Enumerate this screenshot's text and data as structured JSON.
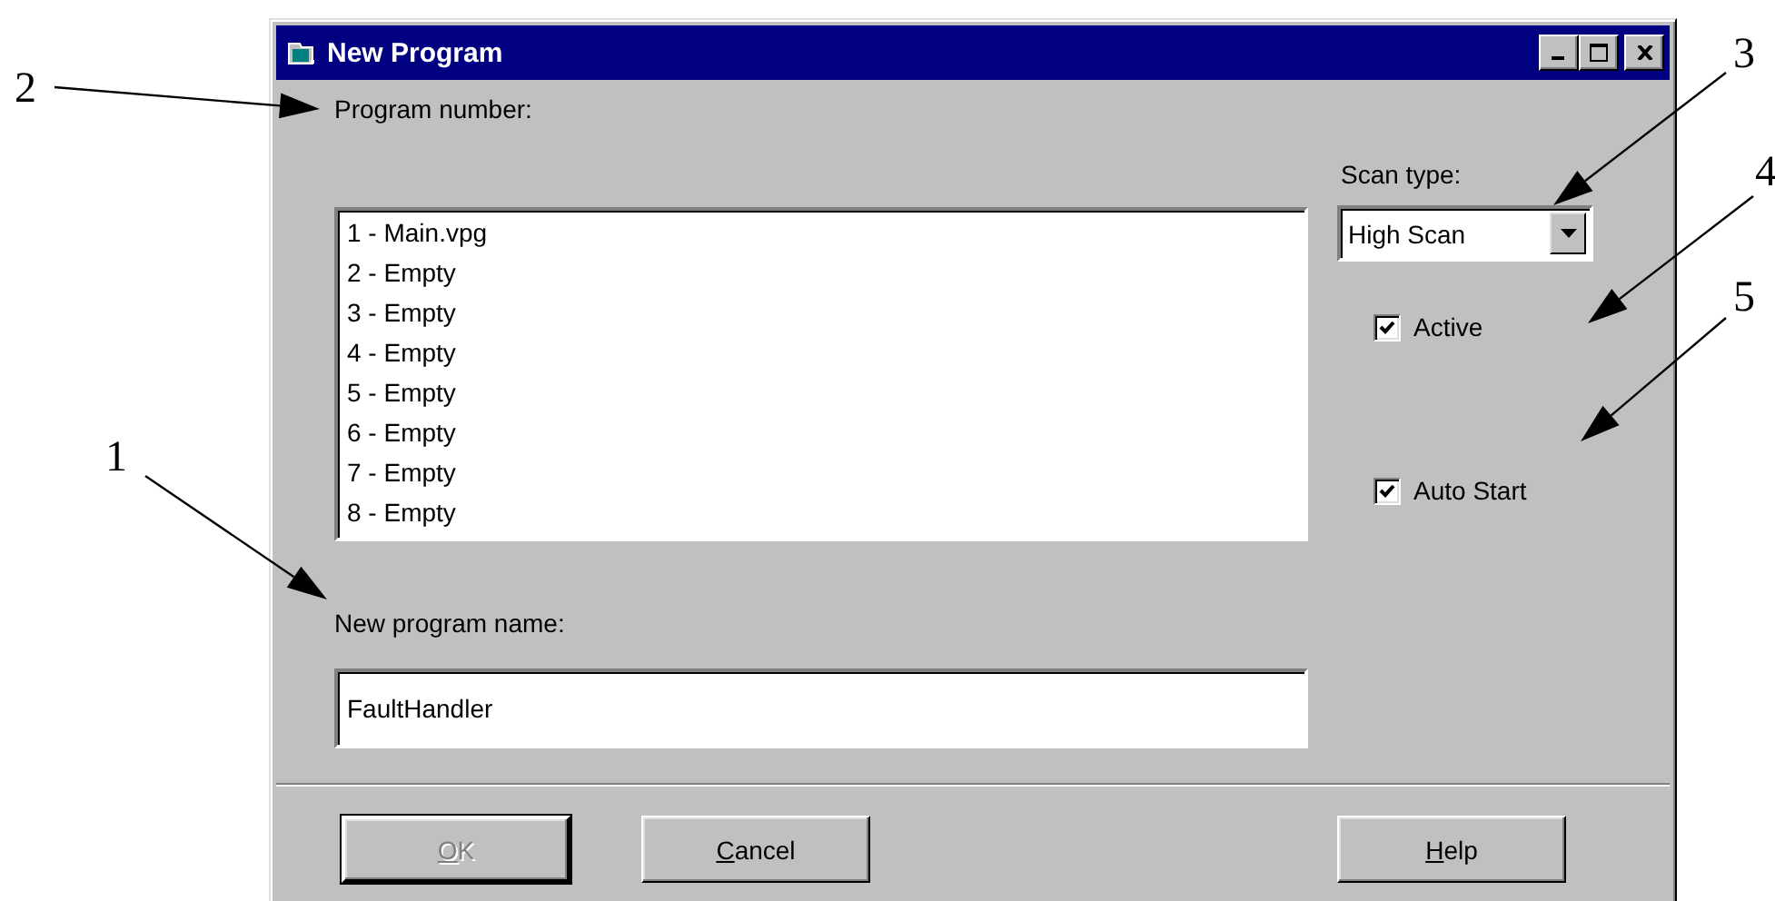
{
  "window": {
    "title": "New Program"
  },
  "program_list": {
    "label": "Program number:",
    "items": [
      {
        "text": "1 - Main.vpg",
        "selected": false
      },
      {
        "text": "2 - Empty",
        "selected": false
      },
      {
        "text": "3 - Empty",
        "selected": false
      },
      {
        "text": "4 - Empty",
        "selected": false
      },
      {
        "text": "5 - Empty",
        "selected": false
      },
      {
        "text": "6 - Empty",
        "selected": false
      },
      {
        "text": "7 - Empty",
        "selected": false
      },
      {
        "text": "8 - Empty",
        "selected": false
      }
    ]
  },
  "scan_type": {
    "label": "Scan type:",
    "value": "High Scan"
  },
  "options": [
    {
      "label": "Active",
      "checked": true
    },
    {
      "label": "Auto Start",
      "checked": true
    }
  ],
  "name_field": {
    "label": "New program name:",
    "value": "FaultHandler"
  },
  "buttons": [
    {
      "label": "OK",
      "disabled": true,
      "default": true
    },
    {
      "label": "Cancel",
      "disabled": false,
      "default": false
    },
    {
      "label": "Help",
      "disabled": false,
      "default": false
    }
  ],
  "callouts": [
    {
      "label": "1"
    },
    {
      "label": "2"
    },
    {
      "label": "3"
    },
    {
      "label": "4"
    },
    {
      "label": "5"
    }
  ]
}
